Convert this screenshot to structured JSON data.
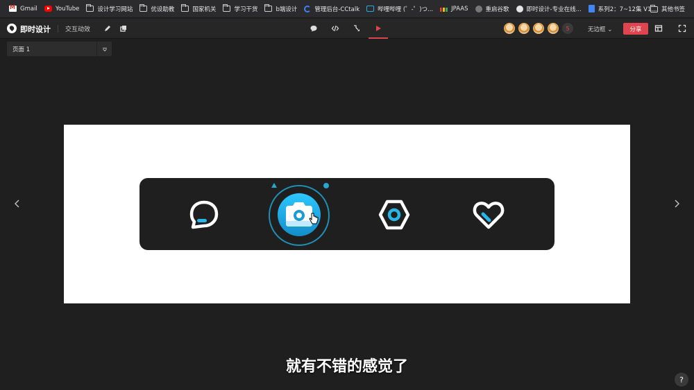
{
  "bookmarks": [
    {
      "label": "Gmail",
      "icon": "gmail"
    },
    {
      "label": "YouTube",
      "icon": "yt"
    },
    {
      "label": "设计学习网站",
      "icon": "folder"
    },
    {
      "label": "优设助教",
      "icon": "folder"
    },
    {
      "label": "国家机关",
      "icon": "folder"
    },
    {
      "label": "学习干货",
      "icon": "folder"
    },
    {
      "label": "b端设计",
      "icon": "folder"
    },
    {
      "label": "管理后台-CCtalk",
      "icon": "ring"
    },
    {
      "label": "哔哩哔哩 (゜-゜)つ...",
      "icon": "tv"
    },
    {
      "label": "JPAAS",
      "icon": "bars"
    },
    {
      "label": "重启谷歌",
      "icon": "globe"
    },
    {
      "label": "即时设计-专业在线...",
      "icon": "logo"
    },
    {
      "label": "系列2：7~12集 V1...",
      "icon": "doc"
    }
  ],
  "other_bookmarks": "其他书签",
  "toolbar": {
    "app_title": "即时设计",
    "interaction": "交互动效",
    "avatar_count": "5",
    "frame_option": "无边框",
    "share": "分享"
  },
  "page_selector": {
    "value": "页面 1"
  },
  "subtitle": "就有不错的感觉了",
  "help": "?",
  "colors": {
    "accent": "#e0454f",
    "tab_active": "#2dc7ff",
    "tabbar_bg": "#1f1f20"
  }
}
